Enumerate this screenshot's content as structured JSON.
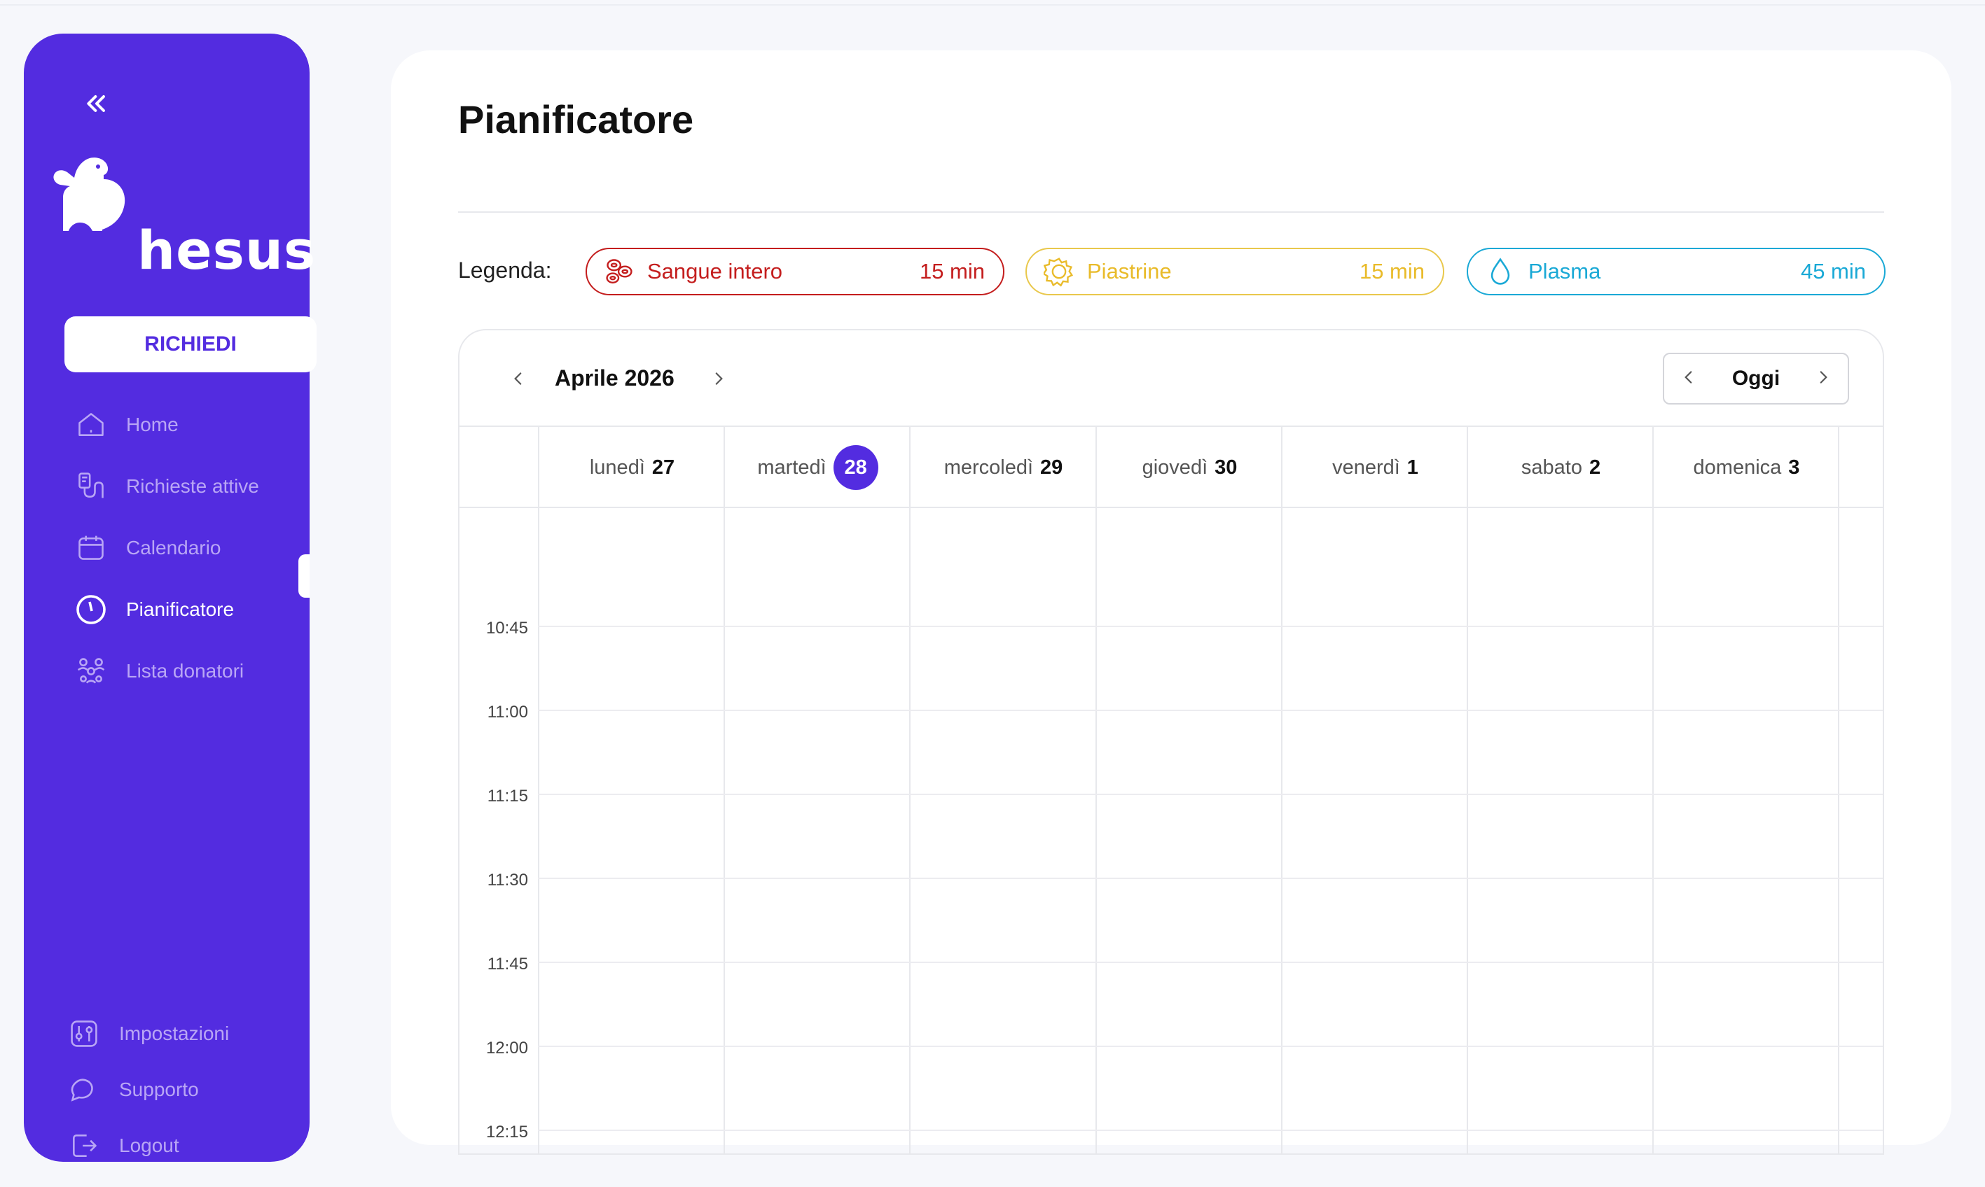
{
  "sidebar": {
    "brand": "hesus",
    "request_button": "RICHIEDI",
    "items": [
      {
        "label": "Home",
        "icon": "home-icon"
      },
      {
        "label": "Richieste attive",
        "icon": "blood-bag-icon"
      },
      {
        "label": "Calendario",
        "icon": "calendar-icon"
      },
      {
        "label": "Pianificatore",
        "icon": "clock-icon",
        "active": true
      },
      {
        "label": "Lista donatori",
        "icon": "users-icon"
      }
    ],
    "bottom_items": [
      {
        "label": "Impostazioni",
        "icon": "sliders-icon"
      },
      {
        "label": "Supporto",
        "icon": "chat-icon"
      },
      {
        "label": "Logout",
        "icon": "logout-icon"
      }
    ]
  },
  "main": {
    "title": "Pianificatore",
    "legend": {
      "label": "Legenda:",
      "items": [
        {
          "name": "Sangue intero",
          "duration": "15 min",
          "color": "#c41e1e",
          "icon": "blood-cells-icon"
        },
        {
          "name": "Piastrine",
          "duration": "15 min",
          "color": "#e9bb2a",
          "icon": "platelet-icon"
        },
        {
          "name": "Plasma",
          "duration": "45 min",
          "color": "#1aa9d6",
          "icon": "drop-icon"
        }
      ]
    },
    "calendar": {
      "month": "Aprile 2026",
      "today_button": "Oggi",
      "days": [
        {
          "name": "lunedì",
          "num": "27"
        },
        {
          "name": "martedì",
          "num": "28",
          "today": true
        },
        {
          "name": "mercoledì",
          "num": "29"
        },
        {
          "name": "giovedì",
          "num": "30"
        },
        {
          "name": "venerdì",
          "num": "1"
        },
        {
          "name": "sabato",
          "num": "2"
        },
        {
          "name": "domenica",
          "num": "3"
        }
      ],
      "times": [
        "10:45",
        "11:00",
        "11:15",
        "11:30",
        "11:45",
        "12:00",
        "12:15"
      ]
    }
  },
  "colors": {
    "accent": "#532ce0",
    "background": "#f6f7fb"
  }
}
